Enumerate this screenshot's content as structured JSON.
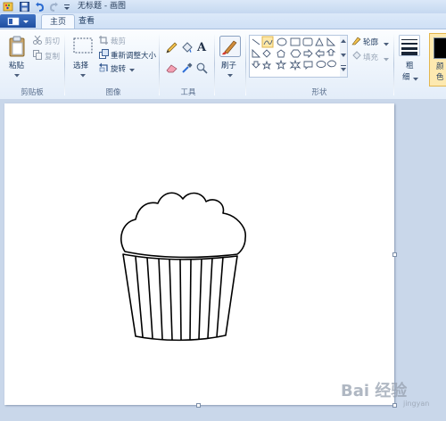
{
  "window": {
    "title": "无标题 - 画图"
  },
  "tabs": {
    "home": "主页",
    "view": "查看"
  },
  "clipboard": {
    "paste": "粘贴",
    "cut": "剪切",
    "copy": "复制",
    "group": "剪贴板"
  },
  "image": {
    "select": "选择",
    "crop": "裁剪",
    "resize": "重新调整大小",
    "rotate": "旋转",
    "group": "图像"
  },
  "tools": {
    "group": "工具"
  },
  "brushes": {
    "label": "刷子"
  },
  "shapes": {
    "group": "形状",
    "outline": "轮廓",
    "fill": "填充"
  },
  "size": {
    "label1": "粗",
    "label2": "细"
  },
  "colors": {
    "color1_label1": "颜",
    "color1_label2": "色",
    "color1_value": "#000000",
    "accent": "#1f4fa0"
  },
  "watermark": {
    "text": "Bai 经验",
    "subtext": "jingyan"
  }
}
